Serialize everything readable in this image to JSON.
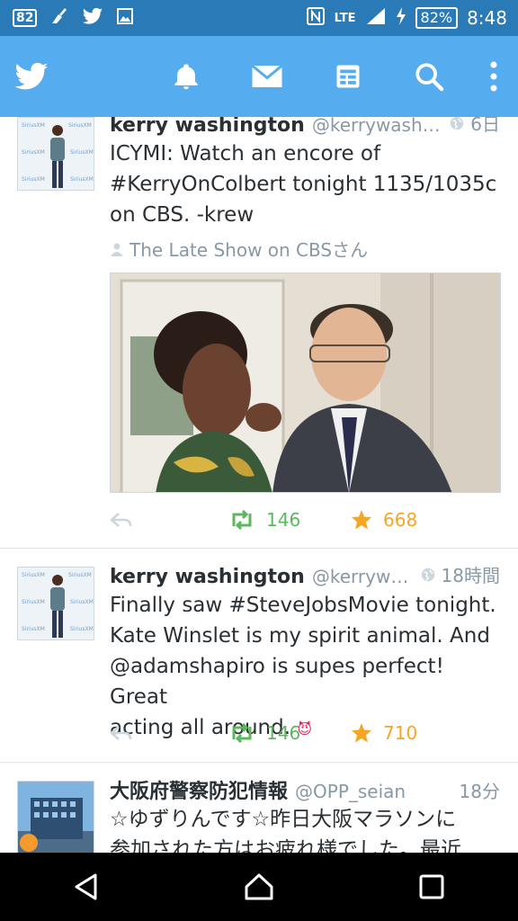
{
  "status_bar": {
    "notif_count": "82",
    "network": "LTE",
    "battery": "82%",
    "clock": "8:48"
  },
  "app_bar": {
    "icons": [
      "twitter-bird-icon",
      "bell-icon",
      "envelope-icon",
      "lists-icon",
      "search-icon",
      "more-vert-icon"
    ]
  },
  "tweets": [
    {
      "name": "kerry washington",
      "handle": "@kerrywashin...",
      "time": "6日",
      "lines": [
        "ICYMI: Watch an encore of",
        "#KerryOnColbert tonight 1135/1035c",
        "on CBS. -krew"
      ],
      "via": "The Late Show on CBSさん",
      "retweets": "146",
      "favorites": "668"
    },
    {
      "name": "kerry washington",
      "handle": "@kerrywas...",
      "time": "18時間",
      "lines": [
        "Finally saw #SteveJobsMovie tonight.",
        "Kate Winslet is my spirit animal. And",
        "@adamshapiro is supes perfect! Great",
        "acting all around."
      ],
      "emoji": "😈",
      "retweets": "146",
      "favorites": "710"
    },
    {
      "name": "大阪府警察防犯情報",
      "handle": "@OPP_seian",
      "time": "18分",
      "lines": [
        "☆ゆずりんです☆昨日大阪マラソンに",
        "参加された方はお疲れ様でした。最近"
      ]
    }
  ],
  "colors": {
    "status_bar": "#2a7ab8",
    "app_bar": "#55acee",
    "retweet": "#5cb85c",
    "favorite": "#f5a623",
    "muted": "#8899a6"
  }
}
